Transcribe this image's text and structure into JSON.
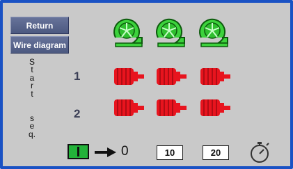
{
  "buttons": {
    "return": "Return",
    "wire_diagram": "Wire diagram"
  },
  "side_label": {
    "part1": [
      "S",
      "t",
      "a",
      "r",
      "t"
    ],
    "part2": [
      "s",
      "e",
      "q."
    ]
  },
  "rows": [
    {
      "label": "1"
    },
    {
      "label": "2"
    }
  ],
  "fans": [
    {
      "icon": "fan-icon",
      "color": "#3cd23c"
    },
    {
      "icon": "fan-icon",
      "color": "#3cd23c"
    },
    {
      "icon": "fan-icon",
      "color": "#3cd23c"
    }
  ],
  "motors": {
    "icon": "motor-icon",
    "color": "#e8141e",
    "per_row": 3
  },
  "sequence": {
    "switch_icon": "toggle-switch-icon",
    "switch_color": "#23b33a",
    "arrow_icon": "arrow-right-icon",
    "value": "0",
    "box1": "10",
    "box2": "20",
    "timer_icon": "stopwatch-icon"
  }
}
